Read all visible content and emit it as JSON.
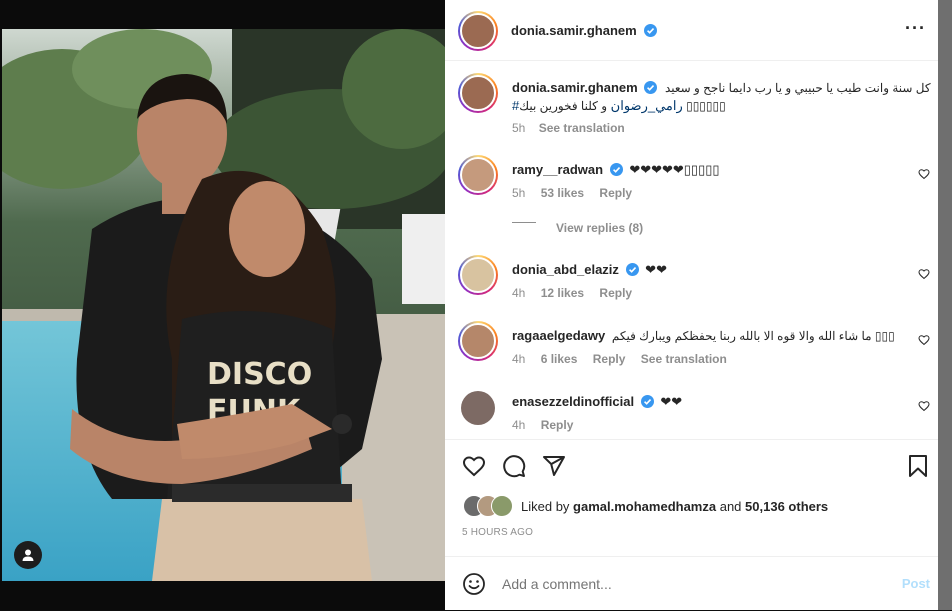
{
  "post": {
    "author": "donia.samir.ghanem",
    "more_label": "···"
  },
  "caption": {
    "username": "donia.samir.ghanem",
    "line1": "كل سنة وانت طيب يا حبيبي و يا رب دايما ناجح و سعيد",
    "line2_text": "و كلنا فخورين بيك ▯▯▯▯▯▯",
    "hashtag": "#رامي_رضوان",
    "time": "5h",
    "see_translation": "See translation"
  },
  "comments": [
    {
      "username": "ramy__radwan",
      "verified": true,
      "text": "❤❤❤❤❤▯▯▯▯▯",
      "time": "5h",
      "likes": "53 likes",
      "reply": "Reply",
      "view_replies": "View replies (8)"
    },
    {
      "username": "donia_abd_elaziz",
      "verified": true,
      "text": "❤❤",
      "time": "4h",
      "likes": "12 likes",
      "reply": "Reply"
    },
    {
      "username": "ragaaelgedawy",
      "verified": false,
      "text": "ما شاء الله والا قوه الا بالله ربنا يحفظكم ويبارك فيكم ▯▯▯",
      "time": "4h",
      "likes": "6 likes",
      "reply": "Reply",
      "see_translation": "See translation"
    },
    {
      "username": "enasezzeldinofficial",
      "verified": true,
      "text": "❤❤",
      "time": "4h",
      "reply": "Reply"
    }
  ],
  "likes": {
    "prefix": "Liked by",
    "user": "gamal.mohamedhamza",
    "and": "and",
    "others": "50,136 others"
  },
  "timestamp": "5 HOURS AGO",
  "add_comment": {
    "placeholder": "Add a comment...",
    "post_label": "Post"
  },
  "colors": {
    "verified": "#3897f0",
    "post_disabled": "#b2dffc",
    "hashtag": "#00376b",
    "muted": "#8e8e8e"
  }
}
